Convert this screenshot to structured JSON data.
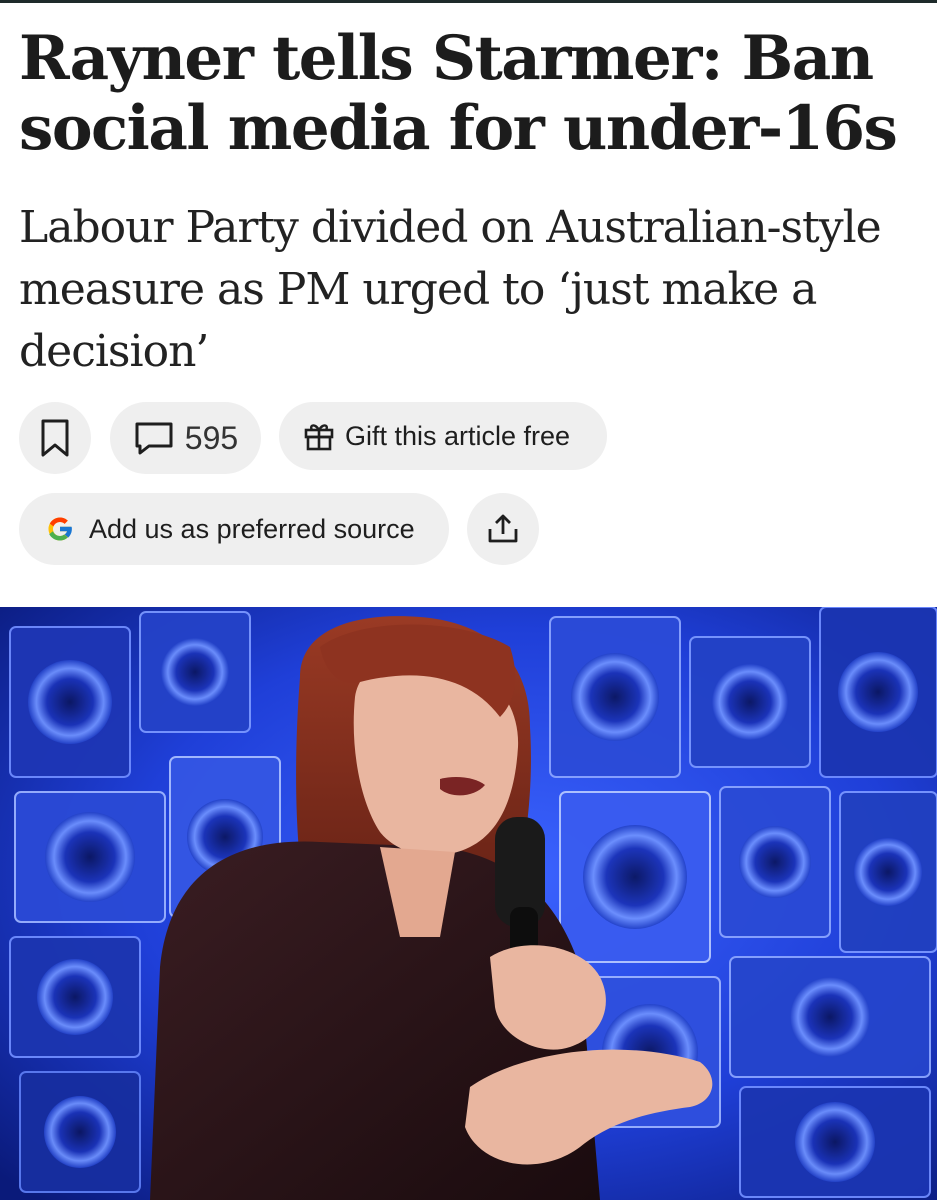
{
  "article": {
    "headline": "Rayner tells Starmer: Ban social media for under-16s",
    "standfirst": "Labour Party divided on Australian-style measure as PM urged to ‘just make a decision’"
  },
  "actions": {
    "bookmark_icon": "bookmark-icon",
    "comment_icon": "speech-bubble-icon",
    "comment_count": "595",
    "gift_icon": "gift-icon",
    "gift_label": "Gift this article free",
    "source_icon": "google-g-icon",
    "source_label": "Add us as preferred source",
    "share_icon": "share-upload-icon"
  },
  "colors": {
    "pill_background": "#efefef",
    "text": "#1c1c1c",
    "top_rule": "#1e2a2a",
    "photo_backdrop": "#1d3bd9"
  }
}
